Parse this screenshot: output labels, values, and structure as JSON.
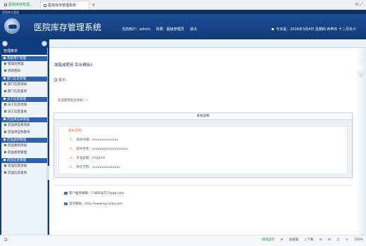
{
  "browser": {
    "tabs": [
      {
        "label": "医院库存管理..."
      },
      {
        "label": "医院库存管理系统"
      }
    ],
    "new_tab": "+",
    "window_controls": "⟲ ⤢"
  },
  "header": {
    "top_label": "医院库存管理",
    "title": "医院库存管理系统",
    "current_user": "当前用户：admin",
    "role": "权限：超级管理员",
    "logout": "退出",
    "date": "今天是：2016年3月4日  星期四  丙申年  十二月廿六"
  },
  "sidebar": {
    "menu_title": "管理菜单",
    "groups": [
      {
        "label": "系统用户管理",
        "items": [
          "管理员管理",
          "修改密码"
        ]
      },
      {
        "label": "部门信息管理",
        "items": [
          "部门信息添加",
          "部门信息查询"
        ]
      },
      {
        "label": "员工信息管理",
        "items": [
          "员工信息添加",
          "员工信息查询"
        ]
      },
      {
        "label": "药品供应商管理",
        "items": [
          "药品供应商添加",
          "药品供应商查询"
        ]
      },
      {
        "label": "药品类别管理",
        "items": [
          "药品类别添加",
          "药品类别管理"
        ]
      },
      {
        "label": "药品信息管理",
        "items": [
          "药品信息添加",
          "药品信息查询"
        ]
      }
    ]
  },
  "main": {
    "breadcrumb": "减脂减肥用 后台模板2",
    "tip": "提示：",
    "welcome": "欢迎使用后台系统！！",
    "sysbox_title": "系统说明",
    "desc_title": "相关说明：",
    "desc_lines": [
      {
        "n": "1、",
        "text": "系统作者：xxxxxxxxxxxxxx"
      },
      {
        "n": "2、",
        "text": "指导老师：xxxxxxxxxxxxxxxxxxx"
      },
      {
        "n": "3、",
        "text": "开发日期：XXXXXX"
      },
      {
        "n": "4、",
        "text": "所在学院：xxxxxxxxxxxxxxx"
      }
    ],
    "contact_qq": "客户服务邮箱：736858727@qq.com",
    "contact_web": "官方网站：http://www.bycxde.com"
  },
  "statusbar": {
    "left": "D",
    "items": [
      "网速监控",
      "⊕",
      "加速器",
      "↓下载",
      "⊡",
      "⊟",
      "◫",
      "⊙",
      "100%"
    ]
  }
}
